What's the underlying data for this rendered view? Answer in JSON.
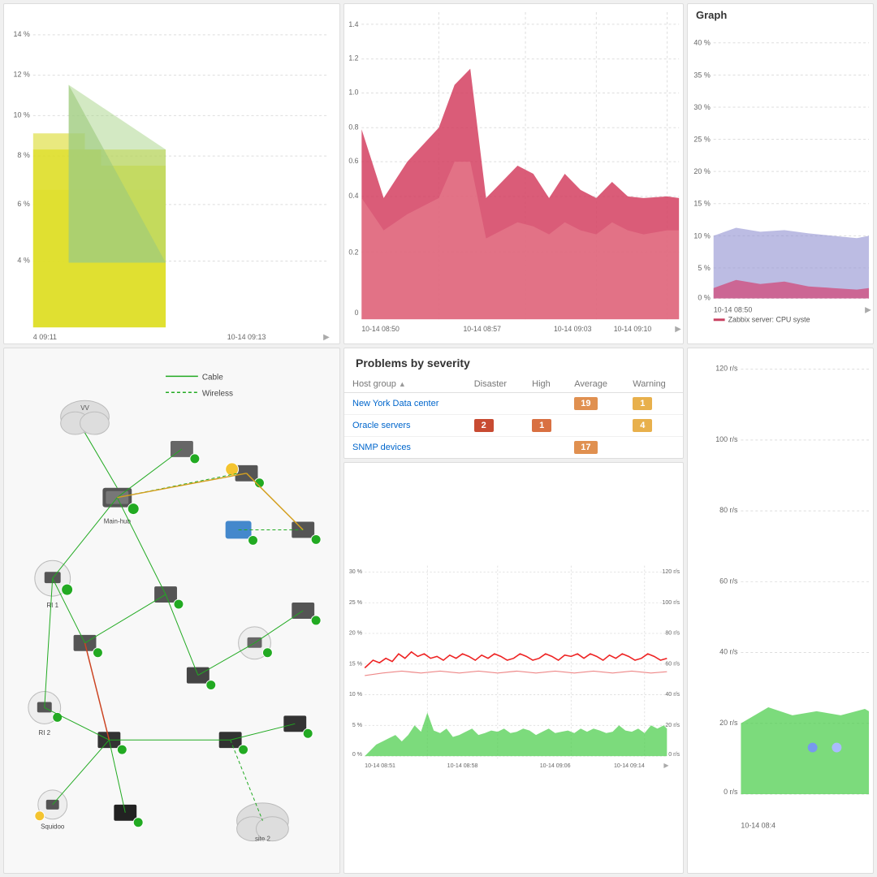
{
  "dashboard": {
    "panels": {
      "top_left": {
        "y_axis": [
          "14 %",
          "12 %",
          "10 %",
          "8 %",
          "6 %",
          "4 %"
        ],
        "x_axis": [
          "4 09:11",
          "10-14 09:13"
        ],
        "chart_type": "area_yellow"
      },
      "top_mid": {
        "y_axis": [
          "1.4",
          "1.2",
          "1.0",
          "0.8",
          "0.6",
          "0.4",
          "0.2",
          "0"
        ],
        "x_axis": [
          "10-14 08:50",
          "10-14 08:57",
          "10-14 09:03",
          "10-14 09:10"
        ],
        "chart_type": "area_red"
      },
      "top_right": {
        "title": "Graph",
        "y_axis": [
          "40 %",
          "35 %",
          "30 %",
          "25 %",
          "20 %",
          "15 %",
          "10 %",
          "5 %",
          "0 %"
        ],
        "x_axis": [
          "10-14 08:50"
        ],
        "legend": "Zabbix server: CPU syste",
        "chart_type": "area_purple"
      },
      "bottom_left": {
        "legend": [
          {
            "label": "Cable",
            "style": "solid"
          },
          {
            "label": "Wireless",
            "style": "dashed"
          }
        ]
      },
      "problems": {
        "title": "Problems by severity",
        "columns": [
          "Host group",
          "Disaster",
          "High",
          "Average",
          "Warning"
        ],
        "rows": [
          {
            "host": "New York Data center",
            "disaster": "",
            "high": "",
            "average": "19",
            "warning": "1"
          },
          {
            "host": "Oracle servers",
            "disaster": "2",
            "high": "1",
            "average": "",
            "warning": "4"
          },
          {
            "host": "SNMP devices",
            "disaster": "",
            "high": "",
            "average": "17",
            "warning": ""
          }
        ]
      },
      "bottom_mid": {
        "y_axis_left": [
          "30 %",
          "25 %",
          "20 %",
          "15 %",
          "10 %",
          "5 %",
          "0 %"
        ],
        "y_axis_right": [
          "120 r/s",
          "100 r/s",
          "80 r/s",
          "60 r/s",
          "40 r/s",
          "20 r/s",
          "0 r/s"
        ],
        "x_axis": [
          "10-14 08:51",
          "10-14 08:58",
          "10-14 09:06",
          "10-14 09:14"
        ]
      },
      "bottom_right": {
        "y_axis_right": [
          "120 r/s",
          "100 r/s",
          "80 r/s",
          "60 r/s",
          "40 r/s",
          "20 r/s",
          "0 r/s"
        ],
        "x_axis": [
          "10-14 08:4"
        ],
        "dots": [
          "blue",
          "blue"
        ]
      }
    }
  }
}
